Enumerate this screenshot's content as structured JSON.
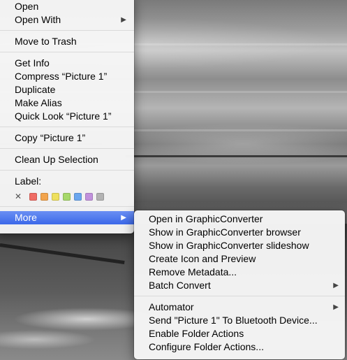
{
  "main_menu": {
    "items": [
      {
        "label": "Open"
      },
      {
        "label": "Open With",
        "submenu": true
      },
      {
        "label": "Move to Trash"
      },
      {
        "label": "Get Info"
      },
      {
        "label": "Compress “Picture 1”"
      },
      {
        "label": "Duplicate"
      },
      {
        "label": "Make Alias"
      },
      {
        "label": "Quick Look “Picture 1”"
      },
      {
        "label": "Copy “Picture 1”"
      },
      {
        "label": "Clean Up Selection"
      },
      {
        "label": "More",
        "submenu": true,
        "highlighted": true
      }
    ],
    "label_section": {
      "title": "Label:",
      "clear_glyph": "✕",
      "colors": [
        {
          "name": "red",
          "hex": "#ef6b63"
        },
        {
          "name": "orange",
          "hex": "#f2a44c"
        },
        {
          "name": "yellow",
          "hex": "#eee05e"
        },
        {
          "name": "green",
          "hex": "#a6d86a"
        },
        {
          "name": "blue",
          "hex": "#6aa6ee"
        },
        {
          "name": "purple",
          "hex": "#c191dc"
        },
        {
          "name": "gray",
          "hex": "#b3b3b3"
        }
      ]
    },
    "submenu_arrow": "▶"
  },
  "more_submenu": {
    "items": [
      {
        "label": "Open in GraphicConverter"
      },
      {
        "label": "Show in GraphicConverter browser"
      },
      {
        "label": "Show in GraphicConverter slideshow"
      },
      {
        "label": "Create Icon and Preview"
      },
      {
        "label": "Remove Metadata..."
      },
      {
        "label": "Batch Convert",
        "submenu": true
      },
      {
        "label": "Automator",
        "submenu": true
      },
      {
        "label": "Send \"Picture 1\" To Bluetooth Device..."
      },
      {
        "label": "Enable Folder Actions"
      },
      {
        "label": "Configure Folder Actions..."
      }
    ]
  },
  "colors": {
    "highlight": "#3b68e9",
    "menu_background": "#f6f6f6"
  }
}
